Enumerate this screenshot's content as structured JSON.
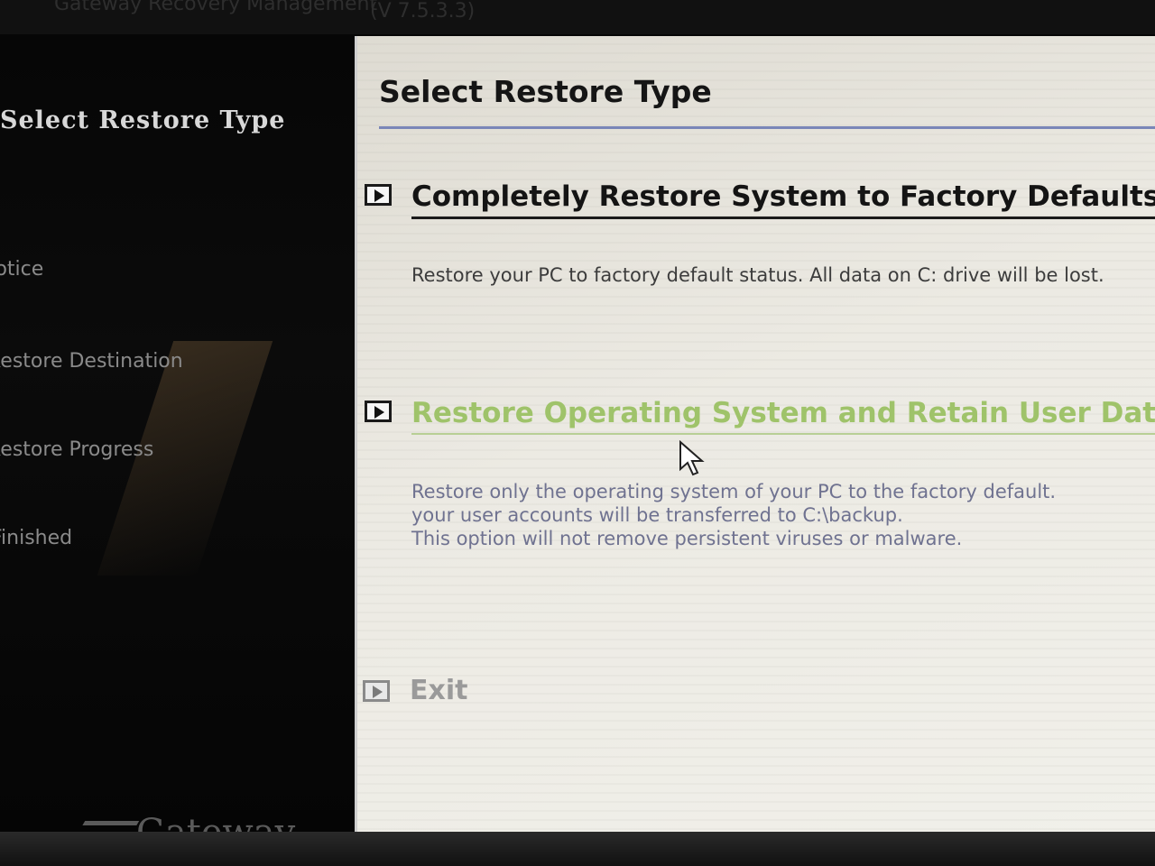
{
  "window": {
    "app_title": "Gateway Recovery Management",
    "version": "(V 7.5.3.3)"
  },
  "sidebar": {
    "heading": "Select Restore Type",
    "steps": [
      {
        "label": "Notice"
      },
      {
        "label": "Restore Destination"
      },
      {
        "label": "Restore Progress"
      },
      {
        "label": "Finished"
      }
    ],
    "brand": "Gateway"
  },
  "main": {
    "title": "Select Restore Type",
    "options": [
      {
        "title": "Completely Restore System to Factory Defaults",
        "description_lines": [
          "Restore your PC to factory default status. All data on C: drive will be lost."
        ]
      },
      {
        "title": "Restore Operating System and Retain User Data",
        "description_lines": [
          "Restore only the operating system of your PC to the factory default.",
          "your user accounts will be transferred to C:\\backup.",
          "This option will not remove persistent viruses or malware."
        ]
      }
    ],
    "exit_label": "Exit"
  },
  "colors": {
    "sidebar_bg": "#070707",
    "content_bg": "#eceae3",
    "title_rule": "#7a86b8",
    "hover_link": "#9fc36a"
  },
  "icons": {
    "option_bullet": "play-arrow-icon",
    "pointer": "mouse-cursor-icon"
  }
}
